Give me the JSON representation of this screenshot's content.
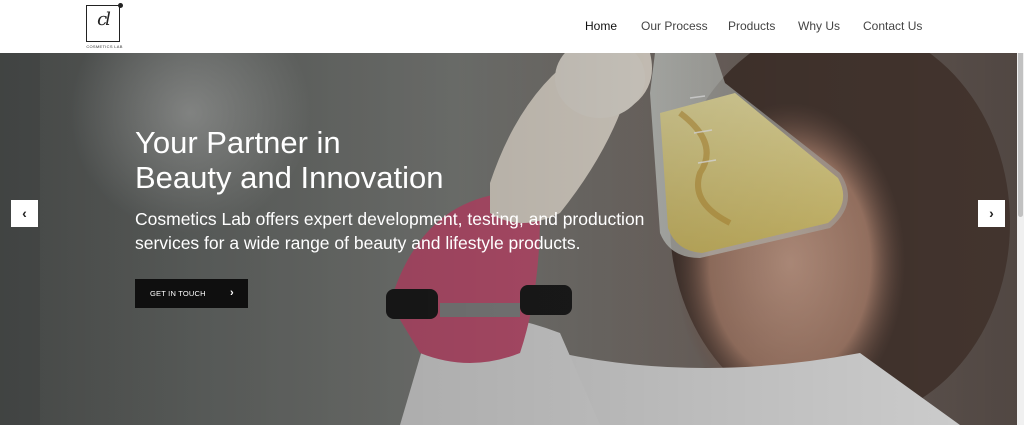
{
  "brand": {
    "logo_mark": "cl",
    "logo_caption": "COSMETICS LAB"
  },
  "nav": {
    "items": [
      {
        "label": "Home",
        "active": true
      },
      {
        "label": "Our Process",
        "active": false
      },
      {
        "label": "Products",
        "active": false
      },
      {
        "label": "Why Us",
        "active": false
      },
      {
        "label": "Contact Us",
        "active": false
      }
    ]
  },
  "hero": {
    "title_line1": "Your Partner in",
    "title_line2": "Beauty and Innovation",
    "subtitle": "Cosmetics Lab offers expert development, testing, and production services for a wide range of beauty and lifestyle products.",
    "cta_label": "GET IN TOUCH",
    "cta_icon": "chevron-right-icon",
    "prev_icon": "chevron-left-icon",
    "next_icon": "chevron-right-icon"
  },
  "colors": {
    "nav_text": "#444444",
    "nav_active": "#111111",
    "cta_bg": "#0f0f0f",
    "hero_text": "#ffffff"
  }
}
